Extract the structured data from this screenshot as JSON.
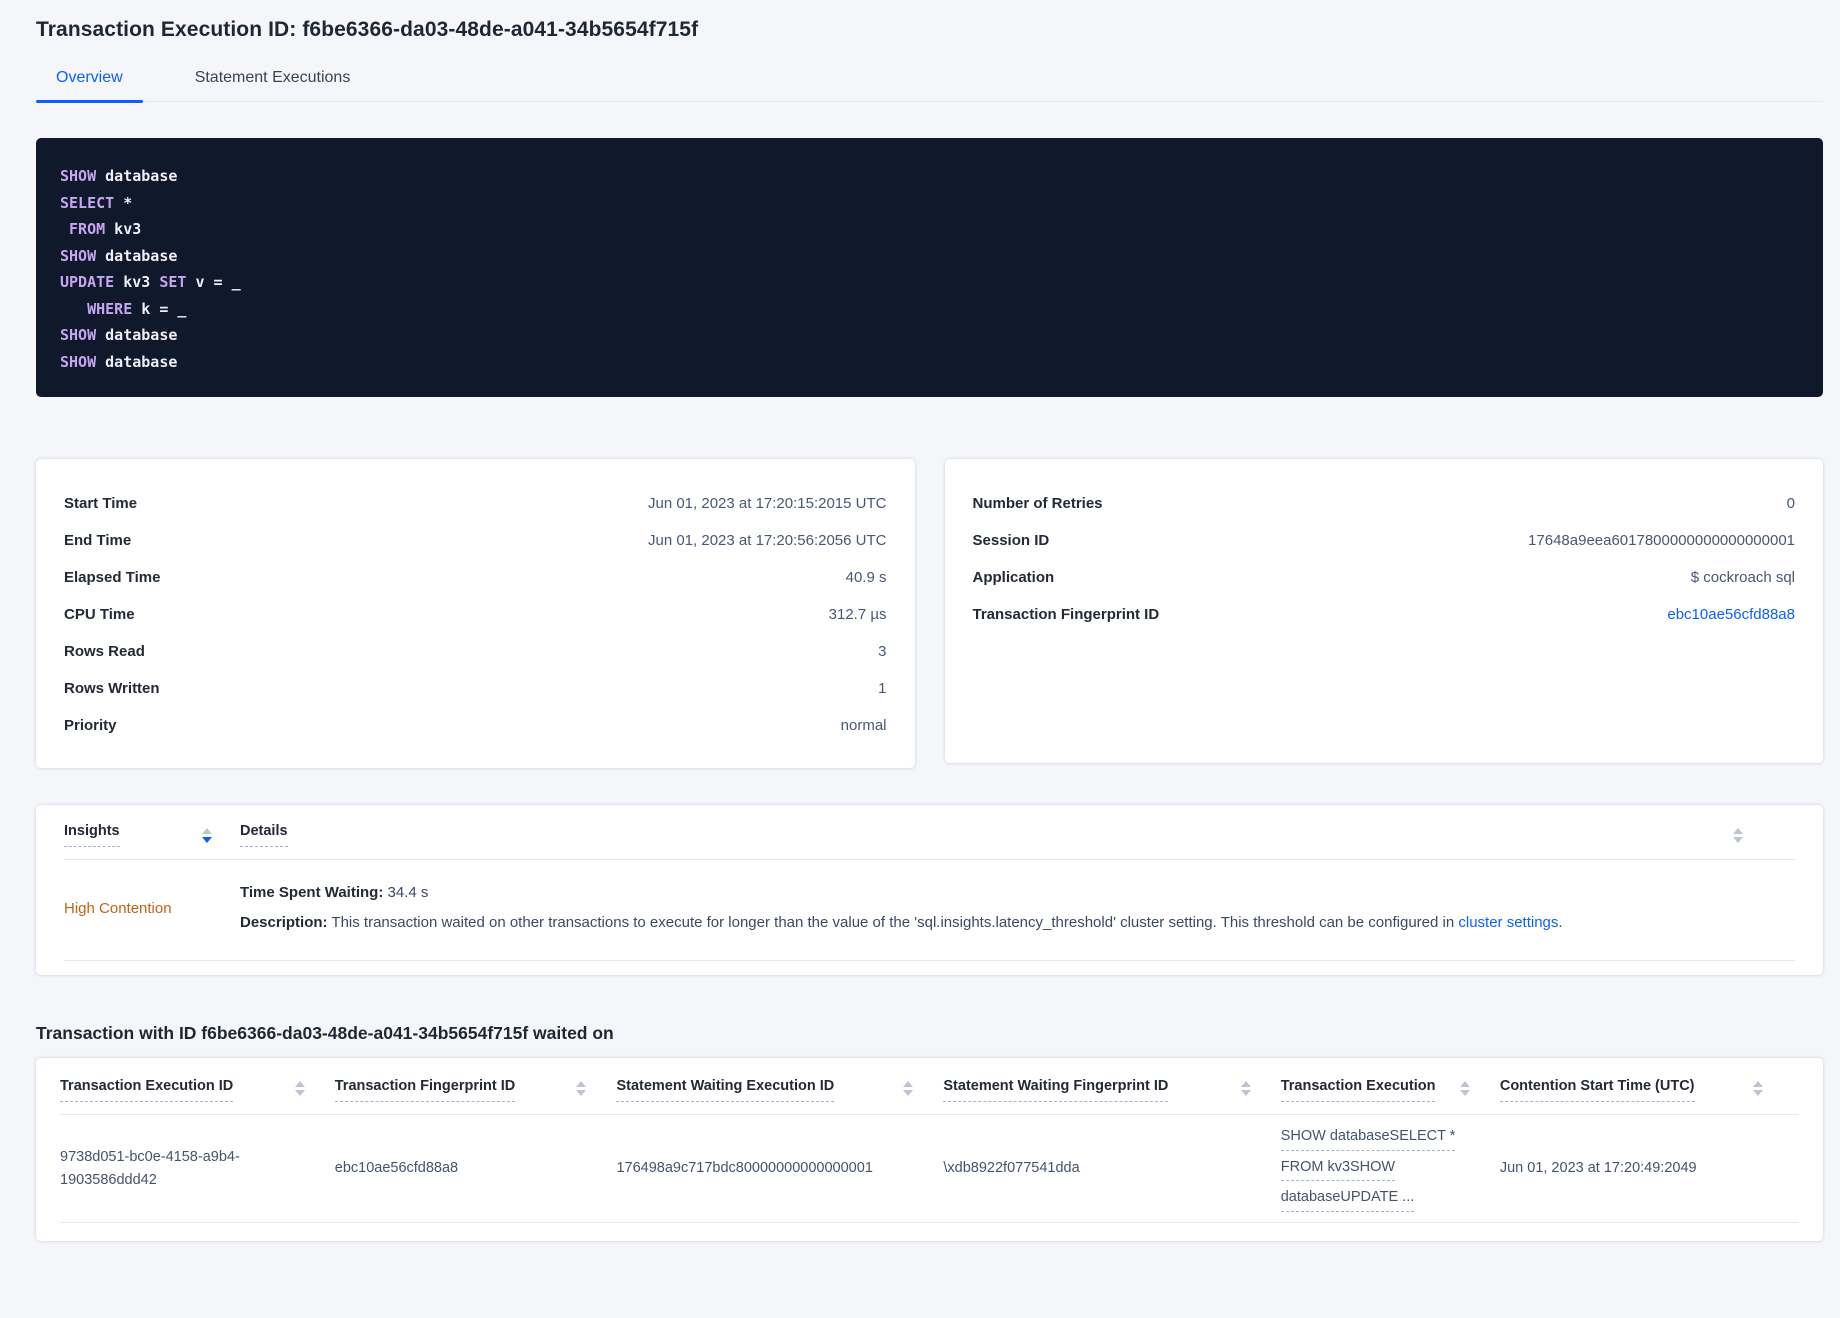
{
  "header": {
    "title": "Transaction Execution ID: f6be6366-da03-48de-a041-34b5654f715f",
    "tabs": [
      {
        "label": "Overview"
      },
      {
        "label": "Statement Executions"
      }
    ]
  },
  "sql": {
    "lines": [
      [
        "SHOW",
        " database"
      ],
      [
        "SELECT",
        " *"
      ],
      [
        " ",
        "FROM",
        " kv3"
      ],
      [
        "SHOW",
        " database"
      ],
      [
        "UPDATE",
        " kv3 ",
        "SET",
        " v = _"
      ],
      [
        "   ",
        "WHERE",
        " k = _"
      ],
      [
        "SHOW",
        " database"
      ],
      [
        "SHOW",
        " database"
      ]
    ]
  },
  "summary": {
    "left": {
      "rows": [
        {
          "label": "Start Time",
          "value": "Jun 01, 2023 at 17:20:15:2015 UTC"
        },
        {
          "label": "End Time",
          "value": "Jun 01, 2023 at 17:20:56:2056 UTC"
        },
        {
          "label": "Elapsed Time",
          "value": "40.9 s"
        },
        {
          "label": "CPU Time",
          "value": "312.7 µs"
        },
        {
          "label": "Rows Read",
          "value": "3"
        },
        {
          "label": "Rows Written",
          "value": "1"
        },
        {
          "label": "Priority",
          "value": "normal"
        }
      ]
    },
    "right": {
      "rows": [
        {
          "label": "Number of Retries",
          "value": "0"
        },
        {
          "label": "Session ID",
          "value": "17648a9eea6017800000000000000001"
        },
        {
          "label": "Application",
          "value": "$ cockroach sql"
        },
        {
          "label": "Transaction Fingerprint ID",
          "value": "ebc10ae56cfd88a8"
        }
      ]
    }
  },
  "insights": {
    "columns": [
      "Insights",
      "Details"
    ],
    "row": {
      "insight": "High Contention",
      "waiting_label": "Time Spent Waiting:",
      "waiting_value": " 34.4 s",
      "description_label": "Description:",
      "description_text": " This transaction waited on other transactions to execute for longer than the value of the 'sql.insights.latency_threshold' cluster setting. This threshold can be configured in ",
      "description_link": "cluster settings",
      "description_suffix": "."
    }
  },
  "waited": {
    "heading": "Transaction with ID f6be6366-da03-48de-a041-34b5654f715f waited on",
    "columns": [
      "Transaction Execution ID",
      "Transaction Fingerprint ID",
      "Statement Waiting Execution ID",
      "Statement Waiting Fingerprint ID",
      "Transaction Execution",
      "Contention Start Time (UTC)"
    ],
    "row": {
      "txn_exec_id": "9738d051-bc0e-4158-a9b4-1903586ddd42",
      "txn_fingerprint_id": "ebc10ae56cfd88a8",
      "stmt_waiting_exec_id": "176498a9c717bdc80000000000000001",
      "stmt_waiting_fingerprint_id": "\\xdb8922f077541dda",
      "txn_execution_lines": [
        "SHOW databaseSELECT *",
        "FROM kv3SHOW",
        "databaseUPDATE ..."
      ],
      "contention_start": "Jun 01, 2023 at 17:20:49:2049"
    }
  },
  "colors": {
    "accent_blue": "#0b5fff",
    "warning_orange": "#bf6414",
    "code_background": "#0f192b",
    "code_keyword": "#c6a5f1",
    "page_background": "#f4f6fa"
  }
}
